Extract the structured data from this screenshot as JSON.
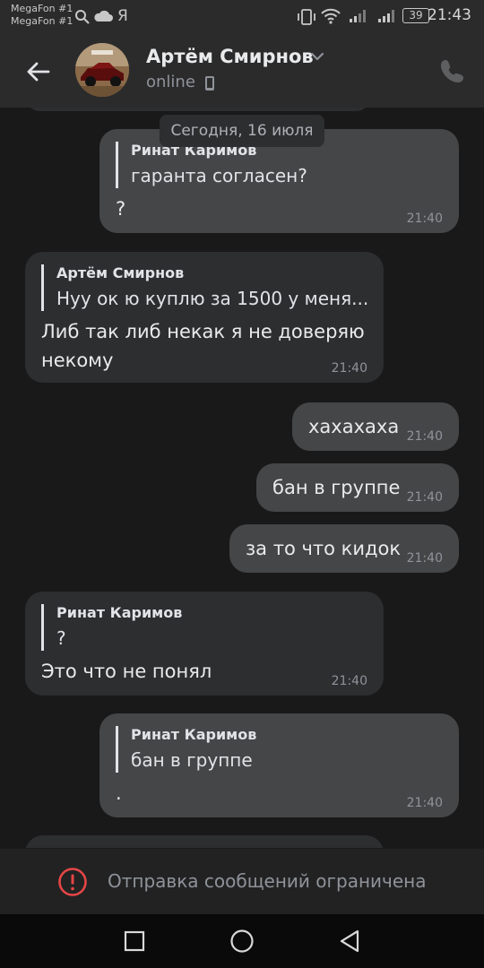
{
  "status_bar": {
    "carrier_1": "MegaFon #1",
    "carrier_2": "MegaFon #1",
    "yandex_glyph": "Я",
    "battery": "39",
    "time": "21:43"
  },
  "header": {
    "contact_name": "Артём Смирнов",
    "status": "online",
    "back_icon": "arrow-left-icon",
    "call_icon": "phone-icon"
  },
  "date_label": "Сегодня, 16 июля",
  "messages": [
    {
      "direction": "out",
      "reply_author": "Ринат Каримов",
      "reply_text": "гаранта согласен?",
      "text": "?",
      "time": "21:40"
    },
    {
      "direction": "in",
      "reply_author": "Артём Смирнов",
      "reply_text": "Нуу ок ю куплю за 1500 у меня...",
      "text_line1": "Либ так либ некак я не доверяю",
      "text_line2": "некому",
      "time": "21:40"
    },
    {
      "direction": "out",
      "text": "хахахаха",
      "time": "21:40"
    },
    {
      "direction": "out",
      "text": "бан в группе",
      "time": "21:40"
    },
    {
      "direction": "out",
      "text": "за то что кидок",
      "time": "21:40"
    },
    {
      "direction": "in",
      "reply_author": "Ринат Каримов",
      "reply_text": "?",
      "text": "Это что не понял",
      "time": "21:40"
    },
    {
      "direction": "out",
      "reply_author": "Ринат Каримов",
      "reply_text": "бан в группе",
      "text": ".",
      "time": "21:40"
    }
  ],
  "restriction": {
    "text": "Отправка сообщений ограничена",
    "icon": "alert-circle-icon",
    "accent": "#e64646"
  },
  "colors": {
    "background": "#19191a",
    "bar": "#2b2b2c",
    "bubble_out": "#454647",
    "bubble_in": "#2d2e30"
  }
}
